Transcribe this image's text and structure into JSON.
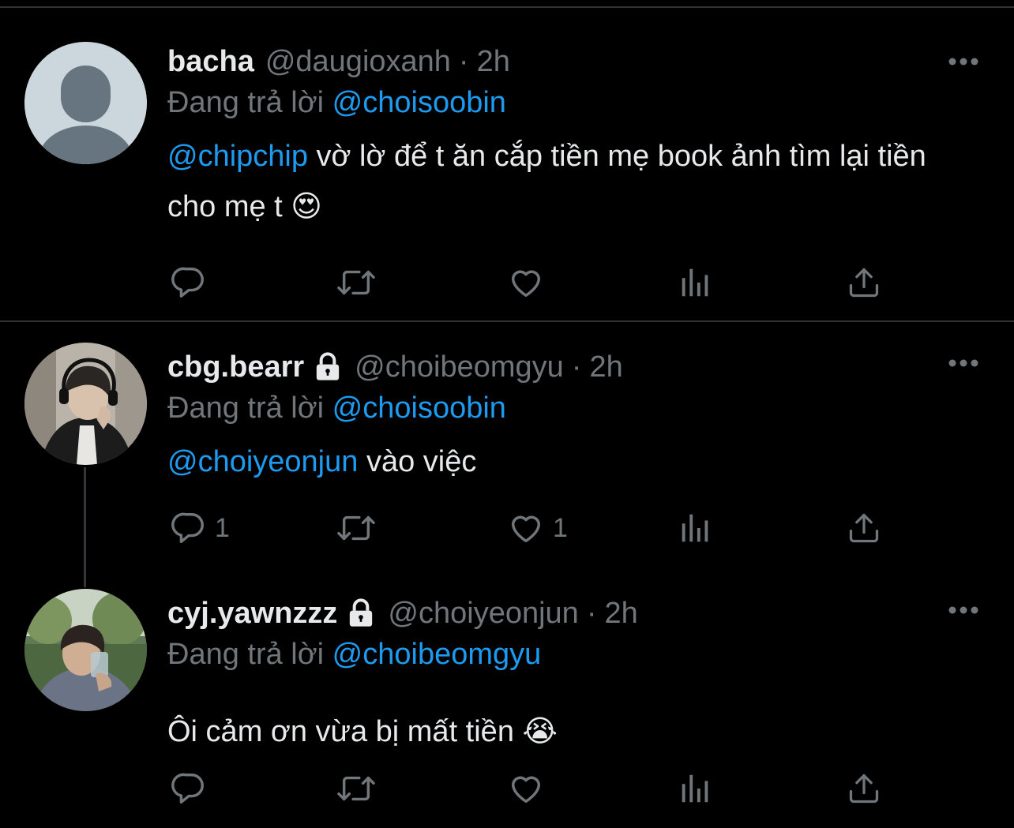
{
  "tweets": [
    {
      "name": "bacha",
      "handle": "@daugioxanh",
      "dot": "·",
      "time": "2h",
      "reply_prefix": "Đang trả lời",
      "reply_to": "@choisoobin",
      "text_mention": "@chipchip",
      "text": " vờ lờ để t ăn cắp tiền mẹ book ảnh tìm lại tiền cho mẹ t",
      "emoji": "😍",
      "locked": false,
      "replies": "",
      "likes": ""
    },
    {
      "name": "cbg.bearr",
      "handle": "@choibeomgyu",
      "dot": "·",
      "time": "2h",
      "reply_prefix": "Đang trả lời",
      "reply_to": "@choisoobin",
      "text_mention": "@choiyeonjun",
      "text": " vào việc",
      "emoji": "",
      "locked": true,
      "replies": "1",
      "likes": "1"
    },
    {
      "name": "cyj.yawnzzz",
      "handle": "@choiyeonjun",
      "dot": "·",
      "time": "2h",
      "reply_prefix": "Đang trả lời",
      "reply_to": "@choibeomgyu",
      "text_mention": "",
      "text": "Ôi cảm ơn vừa bị mất tiền",
      "emoji": "😭",
      "locked": true,
      "replies": "",
      "likes": ""
    }
  ],
  "icons": [
    "reply-icon",
    "retweet-icon",
    "like-icon",
    "analytics-icon",
    "share-icon",
    "more-icon",
    "lock-icon"
  ],
  "colors": {
    "background": "#000000",
    "text": "#e7e9ea",
    "muted": "#71767b",
    "accent": "#1d9bf0",
    "divider": "#2f3336"
  }
}
